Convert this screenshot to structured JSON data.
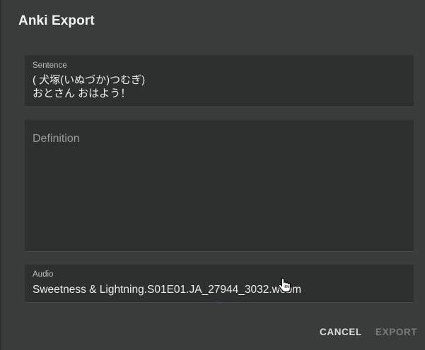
{
  "dialog": {
    "title": "Anki Export"
  },
  "fields": {
    "sentence": {
      "label": "Sentence",
      "value": "( 犬塚(いぬづか)つむぎ)\nおとさん おはよう！"
    },
    "definition": {
      "placeholder": "Definition",
      "value": ""
    },
    "audio": {
      "label": "Audio",
      "value": "Sweetness & Lightning.S01E01.JA_27944_3032.webm"
    }
  },
  "actions": {
    "cancel_label": "CANCEL",
    "export_label": "EXPORT"
  },
  "icons": {
    "cursor": "hand-pointer-icon"
  },
  "colors": {
    "dialog_bg": "#383c3b",
    "field_bg": "#2e3030",
    "disabled_text": "#7a7d7c"
  }
}
